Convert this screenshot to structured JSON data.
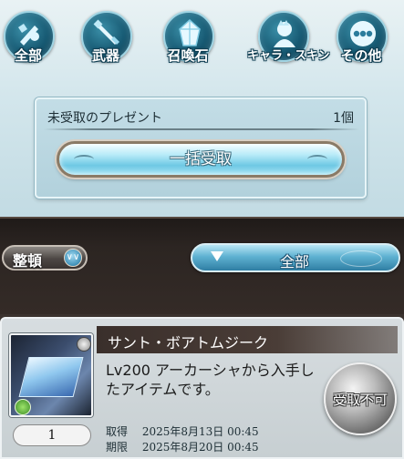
{
  "categories": [
    {
      "label": "全部",
      "icon": "all-icon"
    },
    {
      "label": "武器",
      "icon": "sword-icon"
    },
    {
      "label": "召喚石",
      "icon": "summon-stone-icon"
    },
    {
      "label": "キャラ・スキン",
      "icon": "character-icon"
    },
    {
      "label": "その他",
      "icon": "other-icon"
    }
  ],
  "present": {
    "title": "未受取のプレゼント",
    "count": "1個",
    "receive_all_label": "一括受取"
  },
  "toolbar": {
    "sort_label": "整頓",
    "filter_label": "全部"
  },
  "item": {
    "name": "サント・ボアトムジーク",
    "description": "Lv200 アーカーシャから入手したアイテムです。",
    "quantity": "1",
    "status_button": "受取不可",
    "acquired_label": "取得",
    "acquired_date": "2025年8月13日 00:45",
    "expiry_label": "期限",
    "expiry_date": "2025年8月20日 00:45"
  }
}
